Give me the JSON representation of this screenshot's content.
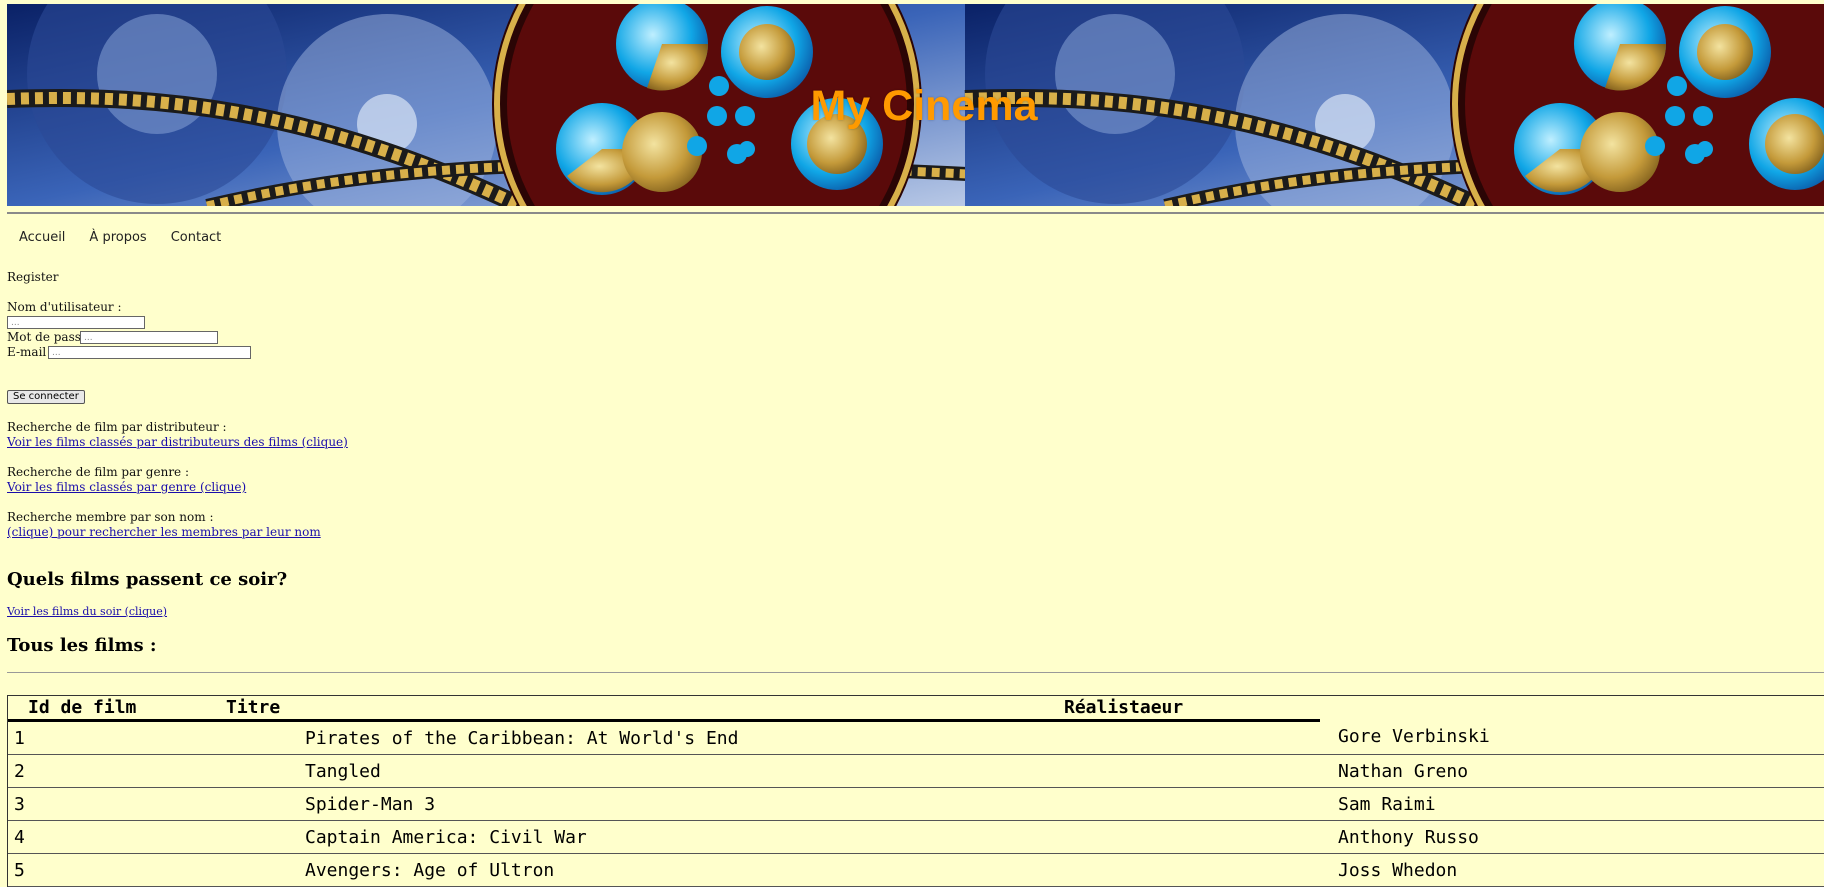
{
  "banner": {
    "title": "My Cinema"
  },
  "nav": {
    "items": [
      "Accueil",
      "À propos",
      "Contact"
    ]
  },
  "register": {
    "heading": "Register",
    "username_label": "Nom d'utilisateur :",
    "username_placeholder": "...",
    "password_label": "Mot de passe :",
    "password_placeholder": "...",
    "email_label": "E-mail :",
    "email_placeholder": "...",
    "submit_label": "Se connecter"
  },
  "search": {
    "distributor_label": "Recherche de film par distributeur :",
    "distributor_link": "Voir les films classés par distributeurs des films (clique)",
    "genre_label": "Recherche de film par genre :",
    "genre_link": "Voir les films classés par genre (clique)",
    "member_label": "Recherche membre par son nom :",
    "member_link": "(clique) pour rechercher les membres par leur nom"
  },
  "tonight": {
    "heading": "Quels films passent ce soir?",
    "link": "Voir les films du soir (clique)"
  },
  "films": {
    "heading": "Tous les films :",
    "columns": [
      "Id de film",
      "Titre",
      "Réalistaeur"
    ],
    "rows": [
      {
        "id": "1",
        "title": "Pirates of the Caribbean: At World's End",
        "director": "Gore Verbinski"
      },
      {
        "id": "2",
        "title": "Tangled",
        "director": "Nathan Greno"
      },
      {
        "id": "3",
        "title": "Spider-Man 3",
        "director": "Sam Raimi"
      },
      {
        "id": "4",
        "title": "Captain America: Civil War",
        "director": "Anthony Russo"
      },
      {
        "id": "5",
        "title": "Avengers: Age of Ultron",
        "director": "Joss Whedon"
      }
    ]
  },
  "colors": {
    "background": "#ffffcc",
    "title": "#ff9a00",
    "link": "#1a0dab"
  }
}
